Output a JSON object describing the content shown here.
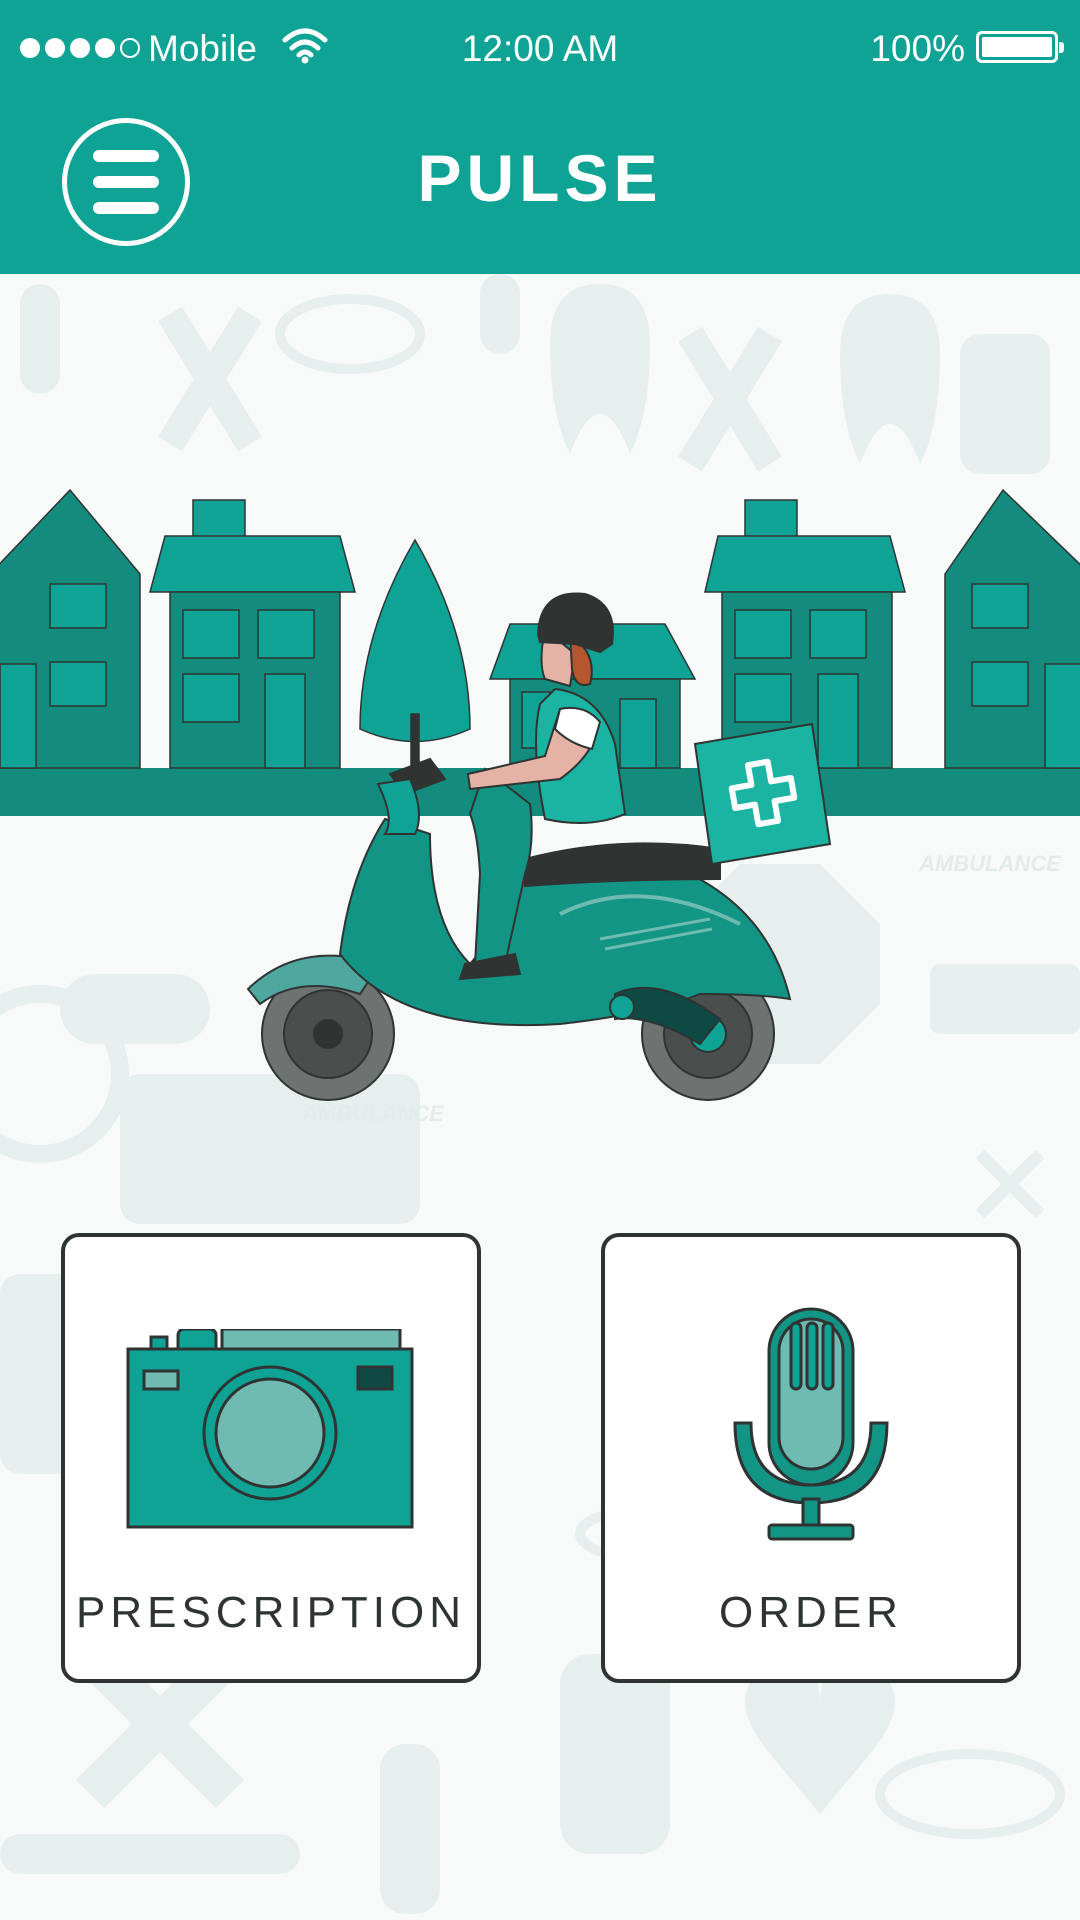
{
  "status_bar": {
    "carrier": "Mobile",
    "time": "12:00 AM",
    "battery_percent": "100%",
    "signal_bars_filled": 4,
    "signal_bars_total": 5,
    "battery_level": 1.0
  },
  "header": {
    "title": "PULSE",
    "menu_icon": "hamburger-menu-icon"
  },
  "hero": {
    "illustration": "delivery-scooter-illustration",
    "box_icon": "medical-cross-icon",
    "ambulance_text": "AMBULANCE"
  },
  "actions": [
    {
      "label": "PRESCRIPTION",
      "icon": "camera-icon"
    },
    {
      "label": "ORDER",
      "icon": "microphone-icon"
    }
  ],
  "colors": {
    "primary": "#0ea394",
    "dark_teal": "#138b7d",
    "light_teal": "#6fbab1",
    "outline": "#2f3433",
    "background": "#f7faf9"
  }
}
